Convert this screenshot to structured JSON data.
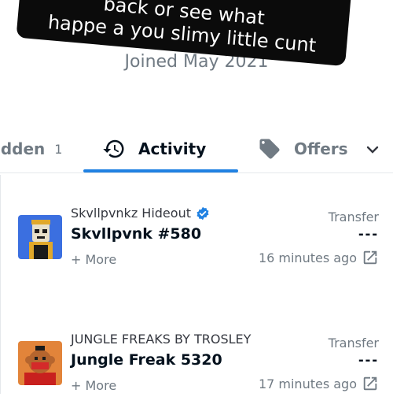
{
  "caption": {
    "line1": "back or see what",
    "line2": "happe a you slimy little cunt"
  },
  "profile": {
    "joined": "Joined May 2021"
  },
  "tabs": [
    {
      "label": "idden",
      "count": "1",
      "icon": "none"
    },
    {
      "label": "Activity",
      "icon": "history-icon",
      "active": true
    },
    {
      "label": "Offers",
      "icon": "tag-icon"
    }
  ],
  "colors": {
    "accent": "#2081e2",
    "verified": "#2081e2"
  },
  "activity": [
    {
      "collection": "Skvllpvnkz Hideout",
      "verified": true,
      "name": "Skvllpvnk #580",
      "more": "+ More",
      "event": "Transfer",
      "price": "---",
      "time": "16 minutes ago"
    },
    {
      "collection": "JUNGLE FREAKS BY TROSLEY",
      "verified": false,
      "name": "Jungle Freak 5320",
      "more": "+ More",
      "event": "Transfer",
      "price": "---",
      "time": "17 minutes ago"
    }
  ]
}
